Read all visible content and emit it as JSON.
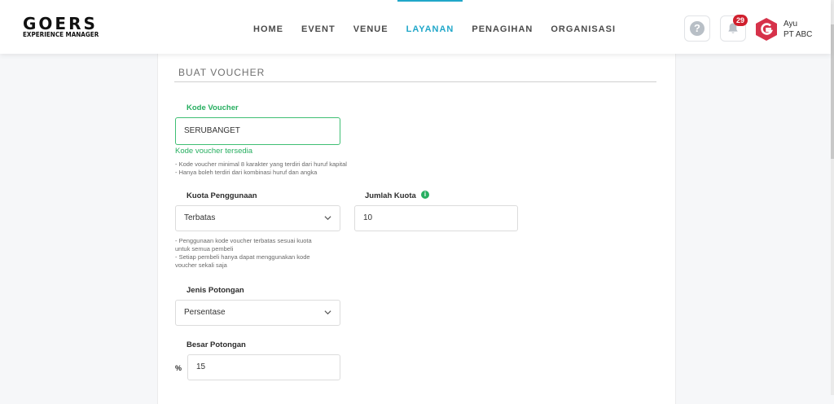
{
  "brand": {
    "name": "GOERS",
    "tagline": "EXPERIENCE MANAGER"
  },
  "nav": [
    {
      "label": "HOME"
    },
    {
      "label": "EVENT"
    },
    {
      "label": "VENUE"
    },
    {
      "label": "LAYANAN"
    },
    {
      "label": "PENAGIHAN"
    },
    {
      "label": "ORGANISASI"
    }
  ],
  "header": {
    "help_glyph": "?",
    "notif_count": "29",
    "user_name": "Ayu",
    "user_org": "PT ABC"
  },
  "form": {
    "title": "BUAT VOUCHER",
    "voucher_code": {
      "label": "Kode Voucher",
      "value": "SERUBANGET",
      "status": "Kode voucher tersedia",
      "hints": [
        "- Kode voucher minimal 8 karakter yang terdiri dari huruf kapital",
        "- Hanya boleh terdiri dari kombinasi huruf dan angka"
      ]
    },
    "usage_quota": {
      "label": "Kuota Penggunaan",
      "value": "Terbatas",
      "hints": [
        "- Penggunaan kode voucher terbatas sesuai kuota",
        "untuk semua pembeli",
        "- Setiap pembeli hanya dapat menggunakan kode",
        "voucher sekali saja"
      ]
    },
    "quota_amount": {
      "label": "Jumlah Kuota",
      "value": "10"
    },
    "discount_type": {
      "label": "Jenis Potongan",
      "value": "Persentase"
    },
    "discount_amount": {
      "label": "Besar Potongan",
      "prefix": "%",
      "value": "15"
    }
  },
  "colors": {
    "accent": "#21a7c9",
    "success": "#27ae60",
    "badge": "#d0202e"
  }
}
